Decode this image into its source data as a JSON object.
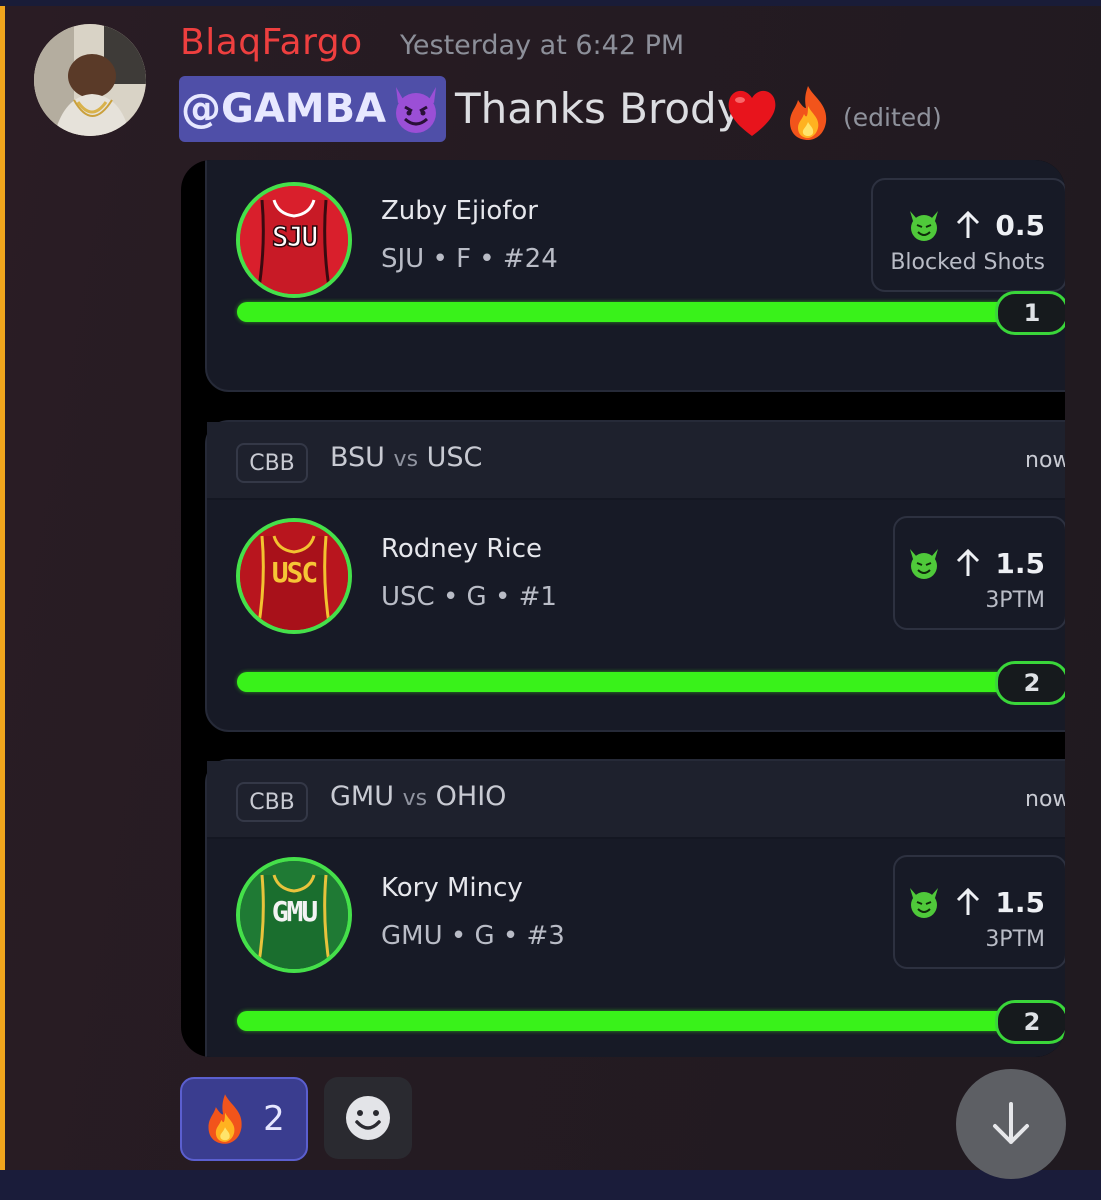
{
  "message": {
    "username": "BlaqFargo",
    "timestamp": "Yesterday at 6:42 PM",
    "mention": "@GAMBA",
    "text": "Thanks Brody",
    "edited_label": "(edited)",
    "accent_color": "#f0a51d",
    "username_color": "#ee3f3f"
  },
  "picks": [
    {
      "league": "",
      "matchup_home": "",
      "matchup_away": "",
      "status": "",
      "jersey_text": "SJU",
      "jersey_color": "#d91f2c",
      "player_name": "Zuby Ejiofor",
      "player_info": "SJU • F • #24",
      "line_value": "0.5",
      "stat_label": "Blocked Shots",
      "result_value": "1",
      "progress_fraction": 1.0
    },
    {
      "league": "CBB",
      "matchup_home": "BSU",
      "matchup_vs": "vs",
      "matchup_away": "USC",
      "status": "now",
      "jersey_text": "USC",
      "jersey_color": "#b8151e",
      "player_name": "Rodney Rice",
      "player_info": "USC • G • #1",
      "line_value": "1.5",
      "stat_label": "3PTM",
      "result_value": "2",
      "progress_fraction": 1.0
    },
    {
      "league": "CBB",
      "matchup_home": "GMU",
      "matchup_vs": "vs",
      "matchup_away": "OHIO",
      "status": "now",
      "jersey_text": "GMU",
      "jersey_color": "#1f7a34",
      "player_name": "Kory Mincy",
      "player_info": "GMU • G • #3",
      "line_value": "1.5",
      "stat_label": "3PTM",
      "result_value": "2",
      "progress_fraction": 1.0
    }
  ],
  "reactions": [
    {
      "emoji": "fire-emoji",
      "count": "2",
      "selected": true
    }
  ],
  "icons": {
    "add_reaction": "smiley-face-icon",
    "scroll": "arrow-down-icon",
    "over": "arrow-up-icon",
    "demon": "goblin-icon"
  },
  "colors": {
    "progress_bar": "#39f21a",
    "mention_bg": "#4f4fa8"
  }
}
